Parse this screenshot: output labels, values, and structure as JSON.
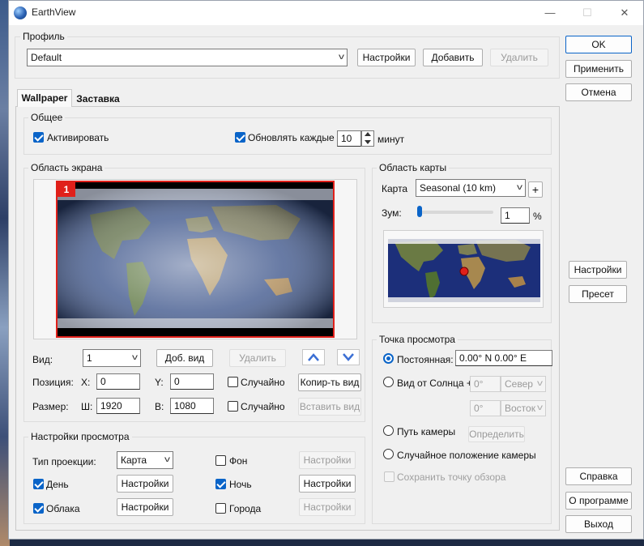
{
  "window": {
    "title": "EarthView"
  },
  "controls": {
    "minimize": "—",
    "maximize": "☐",
    "close": "✕"
  },
  "right_buttons": {
    "ok": "OK",
    "apply": "Применить",
    "cancel": "Отмена",
    "settings": "Настройки",
    "preset": "Пресет",
    "help": "Справка",
    "about": "О программе",
    "exit": "Выход"
  },
  "profile": {
    "label": "Профиль",
    "value": "Default",
    "settings": "Настройки",
    "add": "Добавить",
    "delete": "Удалить"
  },
  "tabs": [
    {
      "label": "Wallpaper",
      "active": true
    },
    {
      "label": "Заставка",
      "active": false
    }
  ],
  "general": {
    "label": "Общее",
    "activate": "Активировать",
    "activate_checked": true,
    "update": "Обновлять каждые",
    "update_checked": true,
    "interval": "10",
    "unit": "минут"
  },
  "screen": {
    "label": "Область экрана",
    "monitor_number": "1",
    "view_label": "Вид:",
    "view_value": "1",
    "add_view": "Доб. вид",
    "delete_view": "Удалить",
    "position_label": "Позиция:",
    "x_label": "X:",
    "x_value": "0",
    "y_label": "Y:",
    "y_value": "0",
    "random1": "Случайно",
    "copy_view": "Копир-ть вид",
    "size_label": "Размер:",
    "w_label": "Ш:",
    "w_value": "1920",
    "h_label": "В:",
    "h_value": "1080",
    "random2": "Случайно",
    "paste_view": "Вставить вид"
  },
  "view_settings": {
    "label": "Настройки просмотра",
    "projection_label": "Тип проекции:",
    "projection_value": "Карта",
    "day": "День",
    "day_checked": true,
    "day_settings": "Настройки",
    "clouds": "Облака",
    "clouds_checked": true,
    "clouds_settings": "Настройки",
    "background": "Фон",
    "background_checked": false,
    "background_settings": "Настройки",
    "night": "Ночь",
    "night_checked": true,
    "night_settings": "Настройки",
    "cities": "Города",
    "cities_checked": false,
    "cities_settings": "Настройки"
  },
  "map_area": {
    "label": "Область карты",
    "map_label": "Карта",
    "map_value": "Seasonal (10 km)",
    "plus": "+",
    "zoom_label": "Зум:",
    "zoom_value": "1",
    "zoom_unit": "%",
    "zoom_level": 0
  },
  "viewpoint": {
    "label": "Точка просмотра",
    "fixed": "Постоянная:",
    "fixed_value": "0.00° N  0.00° E",
    "sun": "Вид от Солнца +",
    "sun_lat": "0°",
    "sun_lat_dir": "Север",
    "sun_lon": "0°",
    "sun_lon_dir": "Восток",
    "camera_path": "Путь камеры",
    "define": "Определить",
    "random_camera": "Случайное положение камеры",
    "save_viewpoint": "Сохранить точку обзора"
  },
  "colors": {
    "accent": "#0a64c8",
    "monitor_border": "#e0201a"
  }
}
